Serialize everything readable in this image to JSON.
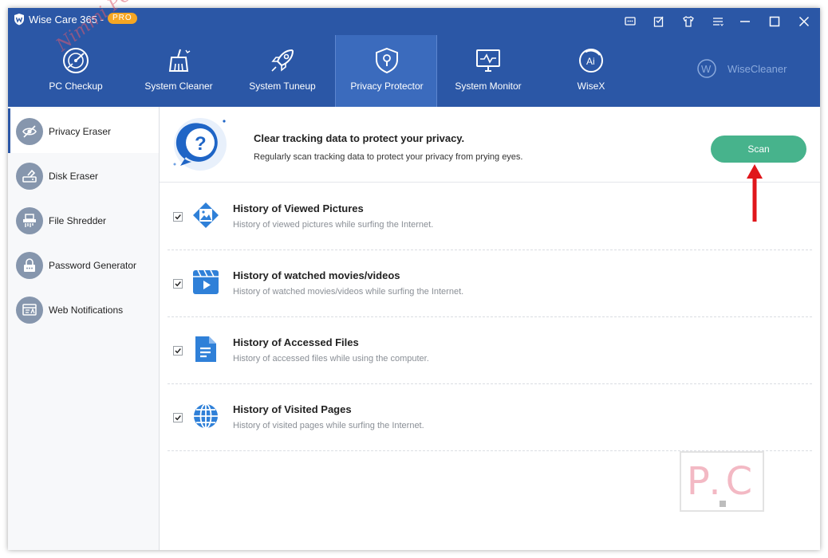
{
  "app": {
    "title": "Wise Care 365 -",
    "badge": "PRO"
  },
  "titlebar_icons": [
    "feedback-icon",
    "notes-icon",
    "skin-icon",
    "menu-icon",
    "minimize-icon",
    "maximize-icon",
    "close-icon"
  ],
  "topnav": {
    "items": [
      {
        "label": "PC Checkup",
        "icon": "radar-icon"
      },
      {
        "label": "System Cleaner",
        "icon": "broom-icon"
      },
      {
        "label": "System Tuneup",
        "icon": "rocket-icon"
      },
      {
        "label": "Privacy Protector",
        "icon": "shield-lock-icon",
        "active": true
      },
      {
        "label": "System Monitor",
        "icon": "monitor-icon"
      },
      {
        "label": "WiseX",
        "icon": "ai-icon"
      }
    ],
    "brand": "WiseCleaner"
  },
  "sidebar": {
    "items": [
      {
        "label": "Privacy Eraser",
        "icon": "eye-slash-icon",
        "active": true
      },
      {
        "label": "Disk Eraser",
        "icon": "disk-eraser-icon"
      },
      {
        "label": "File Shredder",
        "icon": "shredder-icon"
      },
      {
        "label": "Password Generator",
        "icon": "password-lock-icon"
      },
      {
        "label": "Web Notifications",
        "icon": "web-notification-icon"
      }
    ]
  },
  "main": {
    "title": "Clear tracking data to protect your privacy.",
    "subtitle": "Regularly scan tracking data to protect your privacy from prying eyes.",
    "scan_label": "Scan",
    "items": [
      {
        "title": "History of Viewed Pictures",
        "desc": "History of viewed pictures while surfing the Internet.",
        "checked": true,
        "icon": "picture-icon"
      },
      {
        "title": "History of watched movies/videos",
        "desc": "History of watched movies/videos while surfing the Internet.",
        "checked": true,
        "icon": "video-icon"
      },
      {
        "title": "History of Accessed Files",
        "desc": "History of accessed files while using the computer.",
        "checked": true,
        "icon": "file-icon"
      },
      {
        "title": "History of Visited Pages",
        "desc": "History of visited pages while surfing the Internet.",
        "checked": true,
        "icon": "globe-icon"
      }
    ]
  },
  "colors": {
    "brand_blue": "#2b57a6",
    "scan_green": "#47b38c",
    "icon_blue": "#2f80d8",
    "annotation_red": "#e0161b"
  }
}
